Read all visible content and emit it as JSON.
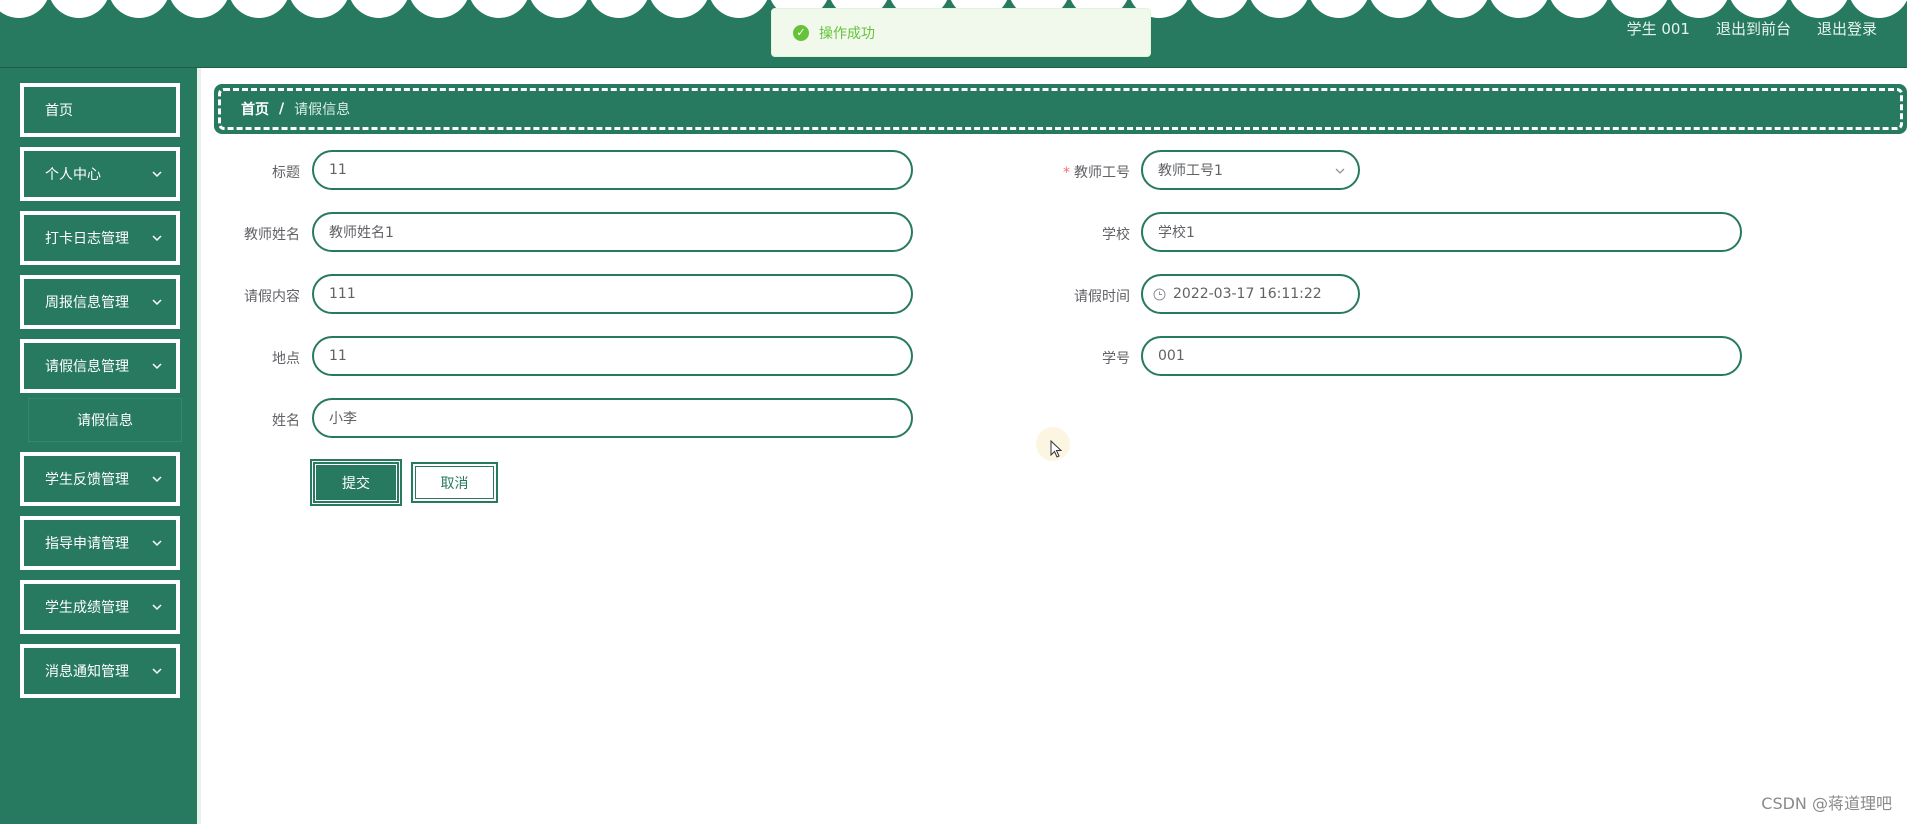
{
  "header": {
    "user_label": "学生 001",
    "back_to_front": "退出到前台",
    "logout": "退出登录"
  },
  "toast": {
    "message": "操作成功",
    "icon": "success-check-icon"
  },
  "sidebar": {
    "items": [
      {
        "label": "首页",
        "has_children": false
      },
      {
        "label": "个人中心",
        "has_children": true
      },
      {
        "label": "打卡日志管理",
        "has_children": true
      },
      {
        "label": "周报信息管理",
        "has_children": true
      },
      {
        "label": "请假信息管理",
        "has_children": true
      },
      {
        "label": "学生反馈管理",
        "has_children": true
      },
      {
        "label": "指导申请管理",
        "has_children": true
      },
      {
        "label": "学生成绩管理",
        "has_children": true
      },
      {
        "label": "消息通知管理",
        "has_children": true
      }
    ],
    "submenu": {
      "label": "请假信息"
    }
  },
  "breadcrumb": {
    "home": "首页",
    "separator": "/",
    "current": "请假信息"
  },
  "form": {
    "title": {
      "label": "标题",
      "value": "11"
    },
    "teacher_id": {
      "label": "教师工号",
      "value": "教师工号1",
      "required": true
    },
    "teacher_name": {
      "label": "教师姓名",
      "value": "教师姓名1"
    },
    "school": {
      "label": "学校",
      "value": "学校1"
    },
    "leave_content": {
      "label": "请假内容",
      "value": "111"
    },
    "leave_time": {
      "label": "请假时间",
      "value": "2022-03-17 16:11:22"
    },
    "location": {
      "label": "地点",
      "value": "11"
    },
    "student_id": {
      "label": "学号",
      "value": "001"
    },
    "name": {
      "label": "姓名",
      "value": "小李"
    },
    "submit_label": "提交",
    "cancel_label": "取消"
  },
  "watermark": "CSDN @蒋道理吧",
  "colors": {
    "primary": "#277a5f",
    "success": "#67c23a",
    "required": "#f56c6c"
  }
}
